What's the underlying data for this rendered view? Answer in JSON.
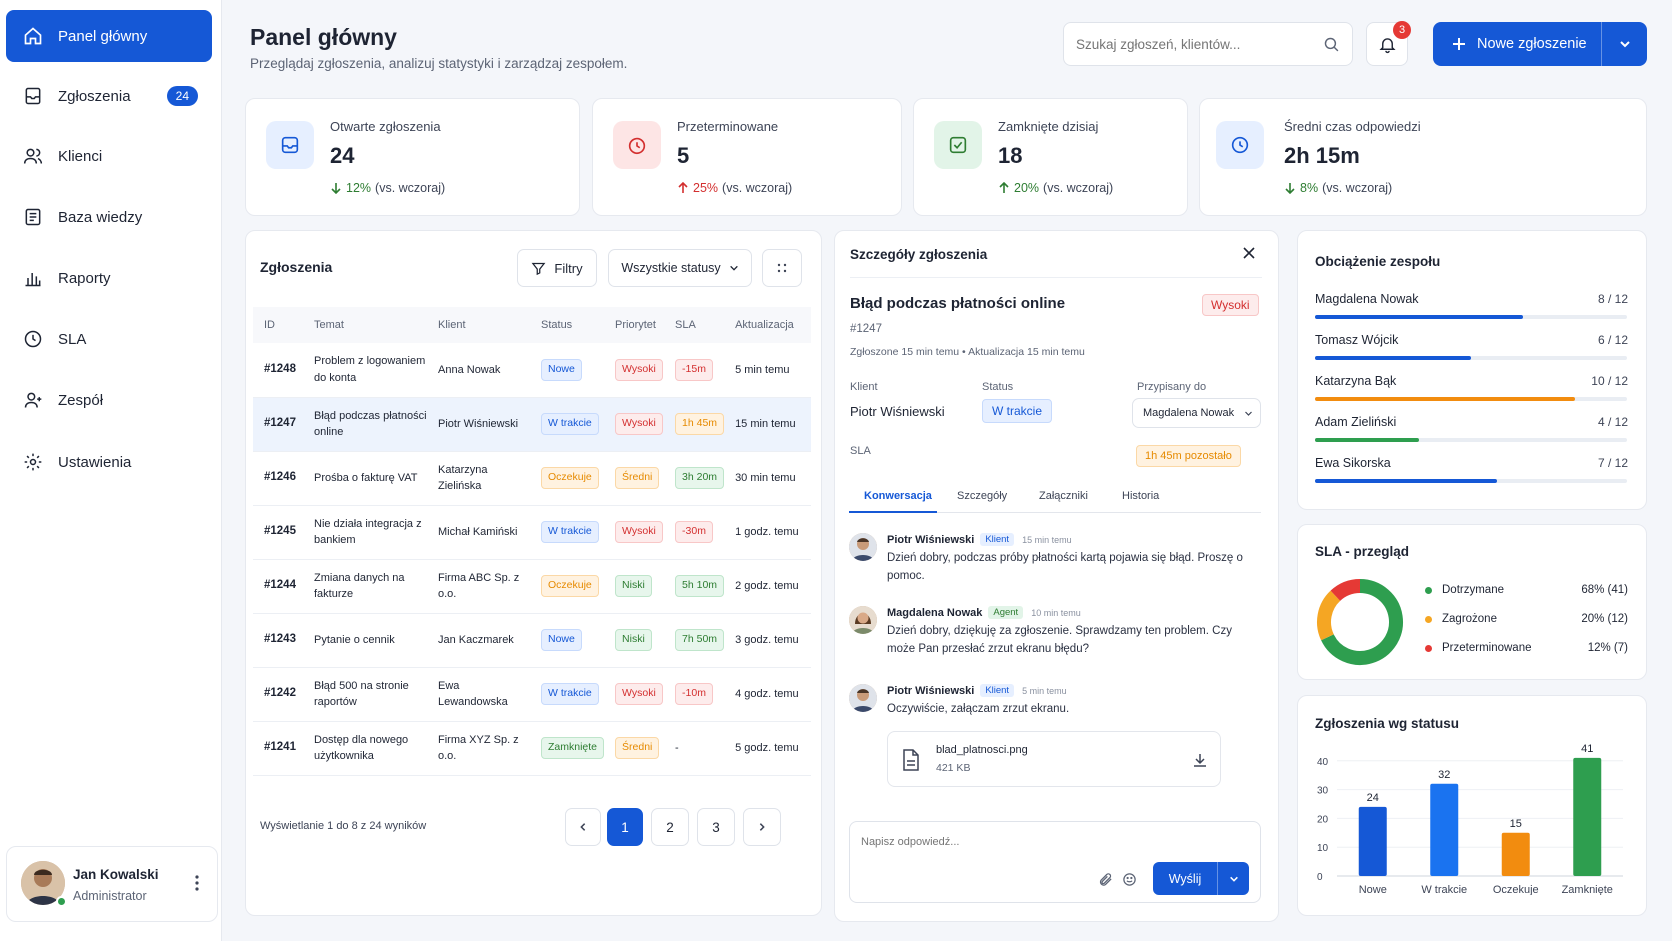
{
  "sidebar": {
    "items": [
      {
        "label": "Panel główny"
      },
      {
        "label": "Zgłoszenia",
        "badge": "24"
      },
      {
        "label": "Klienci"
      },
      {
        "label": "Baza wiedzy"
      },
      {
        "label": "Raporty"
      },
      {
        "label": "SLA"
      },
      {
        "label": "Zespół"
      },
      {
        "label": "Ustawienia"
      }
    ],
    "user": {
      "name": "Jan Kowalski",
      "role": "Administrator"
    }
  },
  "header": {
    "title": "Panel główny",
    "subtitle": "Przeglądaj zgłoszenia, analizuj statystyki i zarządzaj zespołem.",
    "search_placeholder": "Szukaj zgłoszeń, klientów...",
    "notifications": "3",
    "new_button": "Nowe zgłoszenie"
  },
  "stats": [
    {
      "label": "Otwarte zgłoszenia",
      "value": "24",
      "change": "12%",
      "suffix": "(vs. wczoraj)",
      "direction": "down",
      "color": "#2e7d32"
    },
    {
      "label": "Przeterminowane",
      "value": "5",
      "change": "25%",
      "suffix": "(vs. wczoraj)",
      "direction": "up",
      "color": "#d32f2f"
    },
    {
      "label": "Zamknięte dzisiaj",
      "value": "18",
      "change": "20%",
      "suffix": "(vs. wczoraj)",
      "direction": "up",
      "color": "#2e7d32"
    },
    {
      "label": "Średni czas odpowiedzi",
      "value": "2h 15m",
      "change": "8%",
      "suffix": "(vs. wczoraj)",
      "direction": "down",
      "color": "#2e7d32"
    }
  ],
  "tickets": {
    "title": "Zgłoszenia",
    "filter_label": "Filtry",
    "status_filter": "Wszystkie statusy",
    "columns": [
      "ID",
      "Temat",
      "Klient",
      "Status",
      "Priorytet",
      "SLA",
      "Aktualizacja"
    ],
    "rows": [
      {
        "id": "#1248",
        "subject": "Problem z logowaniem do konta",
        "client": "Anna Nowak",
        "status": "Nowe",
        "priority": "Wysoki",
        "sla": "-15m",
        "updated": "5 min temu"
      },
      {
        "id": "#1247",
        "subject": "Błąd podczas płatności online",
        "client": "Piotr Wiśniewski",
        "status": "W trakcie",
        "priority": "Wysoki",
        "sla": "1h 45m",
        "updated": "15 min temu"
      },
      {
        "id": "#1246",
        "subject": "Prośba o fakturę VAT",
        "client": "Katarzyna Zielińska",
        "status": "Oczekuje",
        "priority": "Średni",
        "sla": "3h 20m",
        "updated": "30 min temu"
      },
      {
        "id": "#1245",
        "subject": "Nie działa integracja z bankiem",
        "client": "Michał Kamiński",
        "status": "W trakcie",
        "priority": "Wysoki",
        "sla": "-30m",
        "updated": "1 godz. temu"
      },
      {
        "id": "#1244",
        "subject": "Zmiana danych na fakturze",
        "client": "Firma ABC Sp. z o.o.",
        "status": "Oczekuje",
        "priority": "Niski",
        "sla": "5h 10m",
        "updated": "2 godz. temu"
      },
      {
        "id": "#1243",
        "subject": "Pytanie o cennik",
        "client": "Jan Kaczmarek",
        "status": "Nowe",
        "priority": "Niski",
        "sla": "7h 50m",
        "updated": "3 godz. temu"
      },
      {
        "id": "#1242",
        "subject": "Błąd 500 na stronie raportów",
        "client": "Ewa Lewandowska",
        "status": "W trakcie",
        "priority": "Wysoki",
        "sla": "-10m",
        "updated": "4 godz. temu"
      },
      {
        "id": "#1241",
        "subject": "Dostęp dla nowego użytkownika",
        "client": "Firma XYZ Sp. z o.o.",
        "status": "Zamknięte",
        "priority": "Średni",
        "sla": "-",
        "updated": "5 godz. temu"
      }
    ],
    "footer": "Wyświetlanie 1 do 8 z 24 wyników",
    "pages": [
      "1",
      "2",
      "3"
    ]
  },
  "detail": {
    "title": "Szczegóły zgłoszenia",
    "subject": "Błąd podczas płatności online",
    "priority": "Wysoki",
    "id": "#1247",
    "meta": "Zgłoszone 15 min temu • Aktualizacja 15 min temu",
    "client_label": "Klient",
    "client": "Piotr Wiśniewski",
    "status_label": "Status",
    "status": "W trakcie",
    "assigned_label": "Przypisany do",
    "assigned": "Magdalena Nowak",
    "sla_label": "SLA",
    "sla": "1h 45m pozostało",
    "tabs": [
      "Konwersacja",
      "Szczegóły",
      "Załączniki",
      "Historia"
    ],
    "messages": [
      {
        "name": "Piotr Wiśniewski",
        "role": "Klient",
        "time": "15 min temu",
        "text": "Dzień dobry, podczas próby płatności kartą pojawia się błąd. Proszę o pomoc."
      },
      {
        "name": "Magdalena Nowak",
        "role": "Agent",
        "time": "10 min temu",
        "text": "Dzień dobry, dziękuję za zgłoszenie. Sprawdzamy ten problem. Czy może Pan przesłać zrzut ekranu błędu?"
      },
      {
        "name": "Piotr Wiśniewski",
        "role": "Klient",
        "time": "5 min temu",
        "text": "Oczywiście, załączam zrzut ekranu."
      }
    ],
    "attachment": {
      "name": "blad_platnosci.png",
      "size": "421 KB"
    },
    "reply_placeholder": "Napisz odpowiedź...",
    "send_label": "Wyślij"
  },
  "workload": {
    "title": "Obciążenie zespołu",
    "members": [
      {
        "name": "Magdalena Nowak",
        "label": "8 / 12",
        "fraction": 0.667,
        "color": "#1558d6"
      },
      {
        "name": "Tomasz Wójcik",
        "label": "6 / 12",
        "fraction": 0.5,
        "color": "#1558d6"
      },
      {
        "name": "Katarzyna Bąk",
        "label": "10 / 12",
        "fraction": 0.833,
        "color": "#f28c0f"
      },
      {
        "name": "Adam Zieliński",
        "label": "4 / 12",
        "fraction": 0.333,
        "color": "#2e9e4f"
      },
      {
        "name": "Ewa Sikorska",
        "label": "7 / 12",
        "fraction": 0.583,
        "color": "#1558d6"
      }
    ]
  },
  "sla_overview": {
    "title": "SLA - przegląd",
    "chart_data": {
      "type": "pie",
      "slices": [
        {
          "label": "Dotrzymane",
          "value": 68,
          "count": 41,
          "display": "68% (41)",
          "color": "#2e9e4f"
        },
        {
          "label": "Zagrożone",
          "value": 20,
          "count": 12,
          "display": "20% (12)",
          "color": "#f5a623"
        },
        {
          "label": "Przeterminowane",
          "value": 12,
          "count": 7,
          "display": "12% (7)",
          "color": "#e53935"
        }
      ]
    }
  },
  "status_chart": {
    "title": "Zgłoszenia wg statusu",
    "chart_data": {
      "type": "bar",
      "categories": [
        "Nowe",
        "W trakcie",
        "Oczekuje",
        "Zamknięte"
      ],
      "values": [
        24,
        32,
        15,
        41
      ],
      "colors": [
        "#1558d6",
        "#1a73f0",
        "#f28c0f",
        "#2e9e4f"
      ],
      "yticks": [
        "0",
        "10",
        "20",
        "30",
        "40"
      ],
      "ylim": [
        0,
        42
      ]
    }
  }
}
